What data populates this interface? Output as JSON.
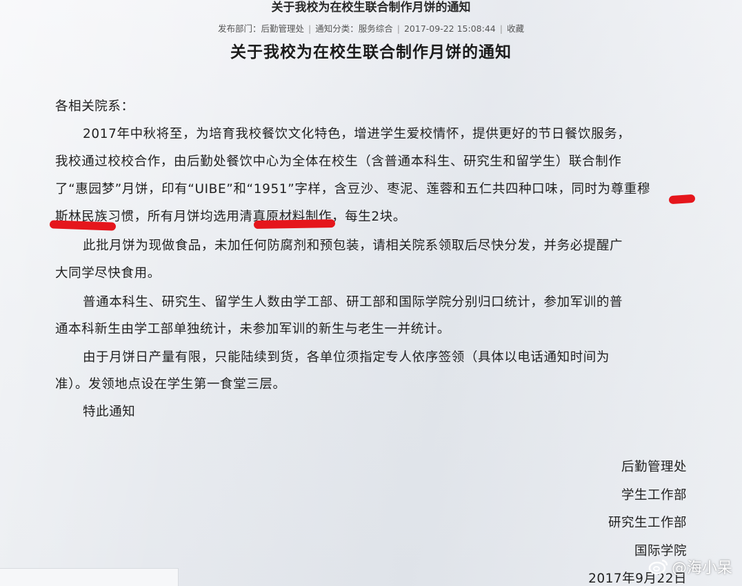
{
  "header": {
    "top_title": "关于我校为在校生联合制作月饼的通知",
    "meta": {
      "department": "发布部门：后勤管理处",
      "category": "通知分类：服务综合",
      "datetime": "2017-09-22 15:08:44",
      "favorite": "收藏"
    },
    "title": "关于我校为在校生联合制作月饼的通知"
  },
  "body": {
    "salutation": "各相关院系：",
    "lines": [
      "2017年中秋将至，为培育我校餐饮文化特色，增进学生爱校情怀，提供更好的节日餐饮服务，",
      "我校通过校校合作，由后勤处餐饮中心为全体在校生（含普通本科生、研究生和留学生）联合制作",
      "了“惠园梦”月饼，印有“UIBE”和“1951”字样，含豆沙、枣泥、莲蓉和五仁共四种口味，同时为尊重穆",
      "斯林民族习惯，所有月饼均选用清真原材料制作，每生2块。",
      "此批月饼为现做食品，未加任何防腐剂和预包装，请相关院系领取后尽快分发，并务必提醒广",
      "大同学尽快食用。",
      "普通本科生、研究生、留学生人数由学工部、研工部和国际学院分别归口统计，参加军训的普",
      "通本科新生由学工部单独统计，未参加军训的新生与老生一并统计。",
      "由于月饼日产量有限，只能陆续到货，各单位须指定专人依序签领（具体以电话通知时间为",
      "准）。发领地点设在学生第一食堂三层。",
      "特此通知"
    ]
  },
  "signatures": [
    "后勤管理处",
    "学生工作部",
    "研究生工作部",
    "国际学院"
  ],
  "date": "2017年9月22日",
  "watermark": "@海小呆",
  "colors": {
    "underline": "#e5161c",
    "background": "#eef0f3"
  }
}
